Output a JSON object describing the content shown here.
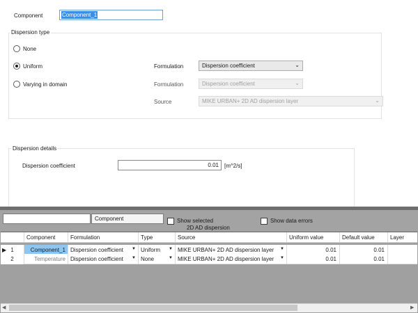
{
  "component": {
    "label": "Component",
    "value": "Component_1"
  },
  "dispersion_type": {
    "title": "Dispersion type",
    "options": [
      {
        "label": "None",
        "checked": false
      },
      {
        "label": "Uniform",
        "checked": true
      },
      {
        "label": "Varying in domain",
        "checked": false
      }
    ],
    "formulation_label": "Formulation",
    "formulation_value": "Dispersion coefficient",
    "formulation2_label": "Formulation",
    "formulation2_value": "Dispersion coefficient",
    "source_label": "Source",
    "source_value": "MIKE URBAN+ 2D AD dispersion layer"
  },
  "dispersion_details": {
    "title": "Dispersion details",
    "coef_label": "Dispersion coefficient",
    "coef_value": "0.01",
    "unit": "[m^2/s]"
  },
  "toolbar": {
    "filter_value": "",
    "filter_field": "Component",
    "show_selected": "Show selected",
    "show_selected_sub": "2D AD dispersion",
    "show_errors": "Show data errors"
  },
  "grid": {
    "headers": [
      "Component",
      "Formulation",
      "Type",
      "Source",
      "Uniform value",
      "Default value",
      "Layer"
    ],
    "rows": [
      {
        "index": "1",
        "marker": "▶",
        "component": "Component_1",
        "formulation": "Dispersion coefficient",
        "type": "Uniform",
        "source": "MIKE URBAN+ 2D AD dispersion layer",
        "uniform": "0.01",
        "default": "0.01",
        "layer": ""
      },
      {
        "index": "2",
        "marker": "",
        "component": "Temperature",
        "formulation": "Dispersion coefficient",
        "type": "None",
        "source": "MIKE URBAN+ 2D AD dispersion layer",
        "uniform": "0.01",
        "default": "0.01",
        "layer": ""
      }
    ]
  },
  "scroll": {
    "left_arrow": "◀",
    "right_arrow": "▶"
  }
}
